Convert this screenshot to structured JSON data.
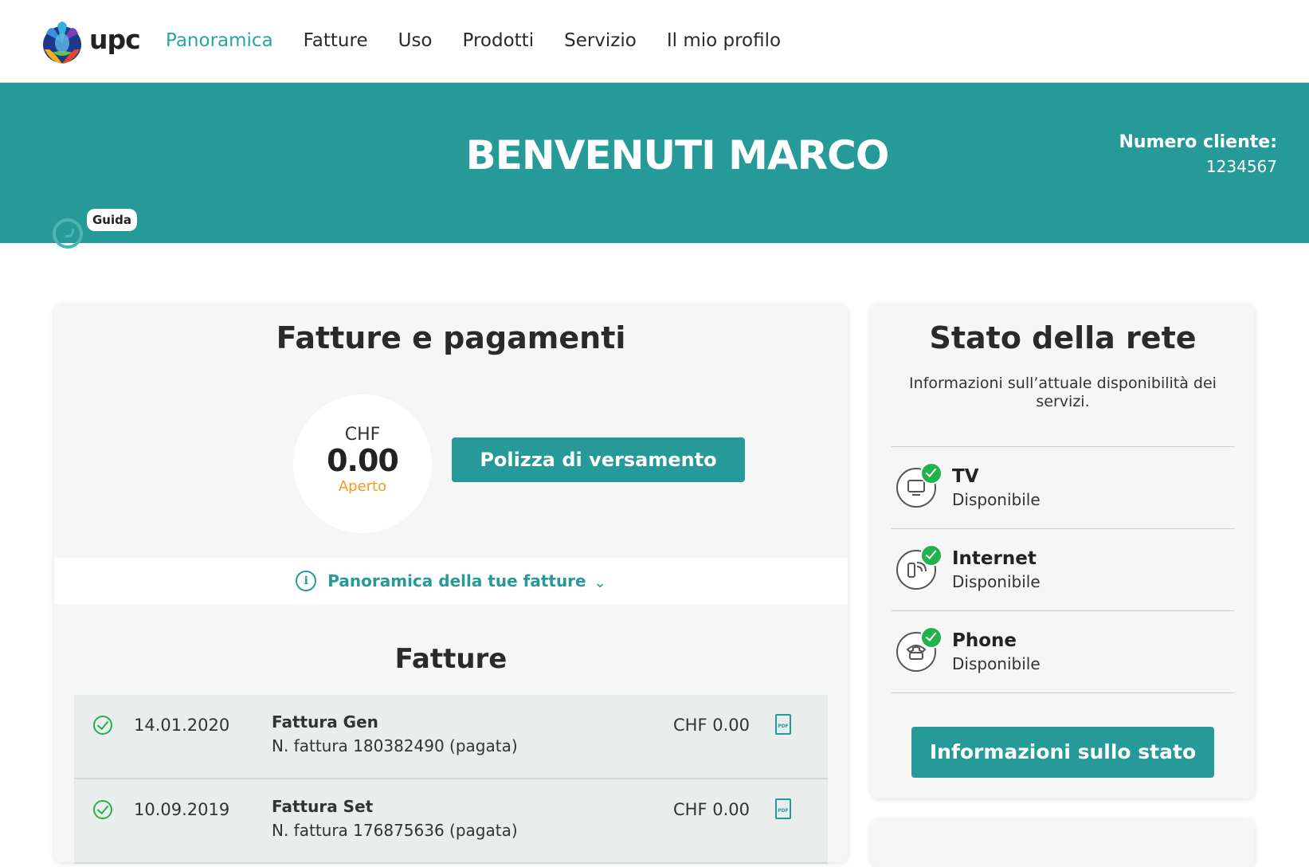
{
  "brand": {
    "logo_text": "upc",
    "accent": "#259a98"
  },
  "nav": {
    "items": [
      {
        "label": "Panoramica",
        "active": true
      },
      {
        "label": "Fatture",
        "active": false
      },
      {
        "label": "Uso",
        "active": false
      },
      {
        "label": "Prodotti",
        "active": false
      },
      {
        "label": "Servizio",
        "active": false
      },
      {
        "label": "Il mio profilo",
        "active": false
      }
    ]
  },
  "banner": {
    "title": "BENVENUTI MARCO",
    "customer_label": "Numero cliente:",
    "customer_number": "1234567",
    "guide_label": "Guida"
  },
  "bills": {
    "title": "Fatture e pagamenti",
    "balance_currency": "CHF",
    "balance_amount": "0.00",
    "balance_status": "Aperto",
    "payment_button": "Polizza di versamento",
    "overview_link": "Panoramica della tue fatture",
    "list_title": "Fatture",
    "rows": [
      {
        "date": "14.01.2020",
        "name": "Fattura Gen",
        "number": "N. fattura 180382490 (pagata)",
        "amount": "CHF 0.00",
        "icon": "pdf-icon"
      },
      {
        "date": "10.09.2019",
        "name": "Fattura Set",
        "number": "N. fattura 176875636 (pagata)",
        "amount": "CHF 0.00",
        "icon": "pdf-icon"
      }
    ]
  },
  "network": {
    "title": "Stato della rete",
    "description": "Informazioni sull’attuale disponibilità dei servizi.",
    "services": [
      {
        "name": "TV",
        "status": "Disponibile",
        "icon": "tv-icon"
      },
      {
        "name": "Internet",
        "status": "Disponibile",
        "icon": "router-icon"
      },
      {
        "name": "Phone",
        "status": "Disponibile",
        "icon": "phone-icon"
      }
    ],
    "status_button": "Informazioni sullo stato"
  }
}
